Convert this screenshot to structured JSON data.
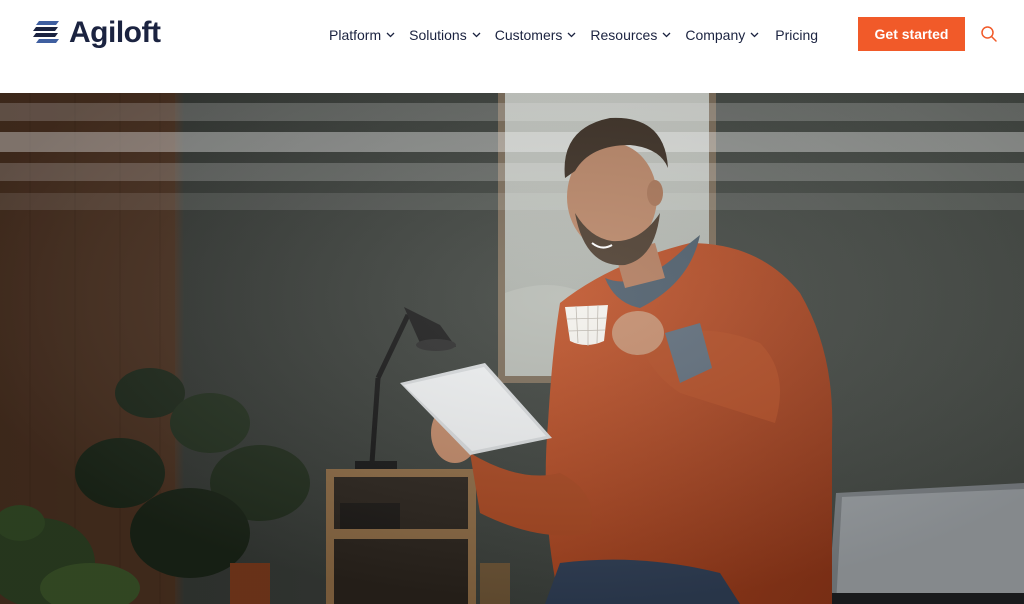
{
  "brand": {
    "name": "Agiloft",
    "logo_icon": "stacked-stripes-logo-icon",
    "color": "#1b2340"
  },
  "nav": {
    "items": [
      {
        "label": "Platform",
        "has_dropdown": true
      },
      {
        "label": "Solutions",
        "has_dropdown": true
      },
      {
        "label": "Customers",
        "has_dropdown": true
      },
      {
        "label": "Resources",
        "has_dropdown": true
      },
      {
        "label": "Company",
        "has_dropdown": true
      }
    ],
    "pricing_label": "Pricing"
  },
  "cta": {
    "label": "Get started",
    "color": "#f15a29"
  },
  "search": {
    "icon": "search-icon",
    "color": "#f15a29"
  },
  "hero": {
    "image": "man-in-orange-sweater-with-tablet-and-coffee",
    "accent": "#b84a22"
  }
}
